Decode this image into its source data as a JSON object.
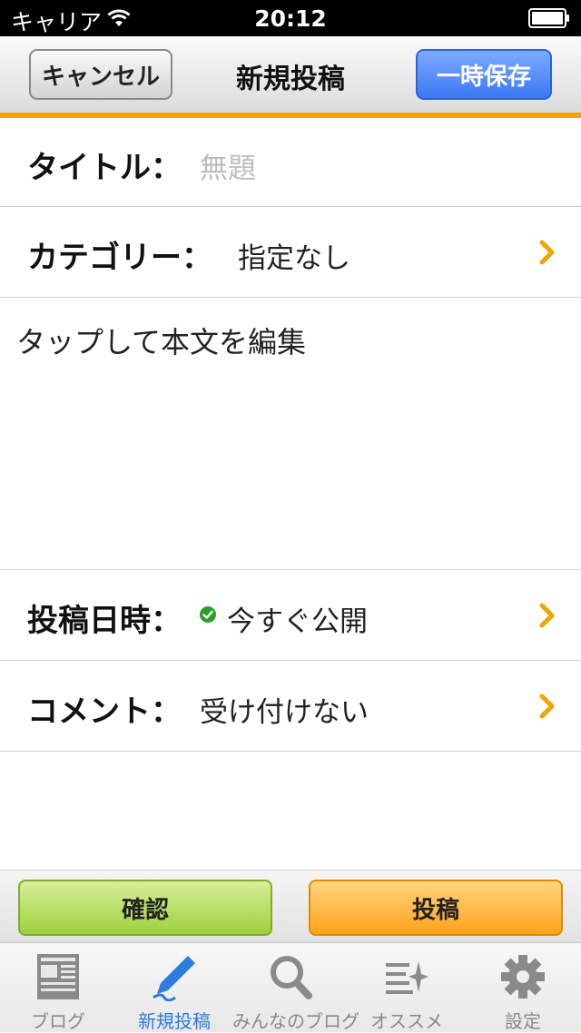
{
  "status_bar": {
    "carrier": "キャリア",
    "time": "20:12",
    "wifi_icon": "wifi-icon",
    "battery_icon": "battery-icon"
  },
  "nav": {
    "cancel_label": "キャンセル",
    "title": "新規投稿",
    "save_label": "一時保存"
  },
  "form": {
    "title_label": "タイトル：",
    "title_placeholder": "無題",
    "category_label": "カテゴリー：",
    "category_value": "指定なし",
    "body_placeholder": "タップして本文を編集",
    "post_date_label": "投稿日時：",
    "post_date_value": "今すぐ公開",
    "comment_label": "コメント：",
    "comment_value": "受け付けない"
  },
  "actions": {
    "confirm_label": "確認",
    "post_label": "投稿"
  },
  "tabs": [
    {
      "label": "ブログ",
      "icon": "blog-icon",
      "active": false
    },
    {
      "label": "新規投稿",
      "icon": "pencil-icon",
      "active": true
    },
    {
      "label": "みんなのブログ",
      "icon": "search-icon",
      "active": false
    },
    {
      "label": "オススメ",
      "icon": "sparkle-list-icon",
      "active": false
    },
    {
      "label": "設定",
      "icon": "gear-icon",
      "active": false
    }
  ],
  "colors": {
    "accent_orange": "#f0a500",
    "chevron": "#f0a500",
    "save_blue": "#3a79f4",
    "confirm_green": "#9fd03c",
    "post_orange": "#ffa21a",
    "active_tab": "#2b7be0",
    "check_green": "#2a9d2a"
  }
}
